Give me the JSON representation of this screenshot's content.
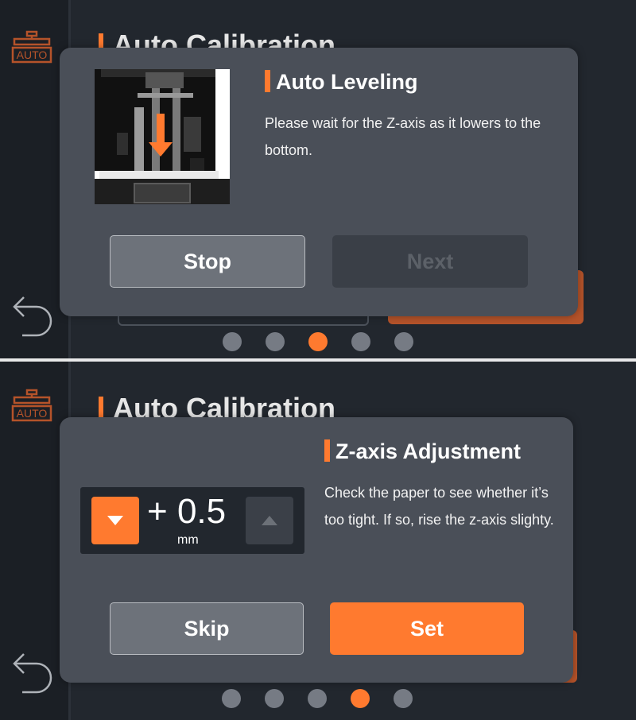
{
  "background": {
    "page_title": "Auto Calibration",
    "auto_icon_label": "AUTO"
  },
  "screen_1": {
    "dialog": {
      "title": "Auto Leveling",
      "text": "Please wait for the Z-axis as it lowers to the bottom.",
      "image_icon": "printer-lowering-arrow",
      "stop_label": "Stop",
      "next_label": "Next"
    },
    "pagination": {
      "count": 5,
      "active_index": 2
    }
  },
  "screen_2": {
    "dialog": {
      "title": "Z-axis Adjustment",
      "text": "Check the paper to see whether it’s too tight. If so, rise the z-axis slighty.",
      "stepper": {
        "sign": "+",
        "value": "0.5",
        "unit": "mm"
      },
      "skip_label": "Skip",
      "set_label": "Set"
    },
    "pagination": {
      "count": 5,
      "active_index": 3
    }
  },
  "colors": {
    "accent": "#ff7a2f",
    "dialog_bg": "#4a4f58",
    "screen_bg": "#22272e",
    "disabled_button": "#3a3f47"
  }
}
